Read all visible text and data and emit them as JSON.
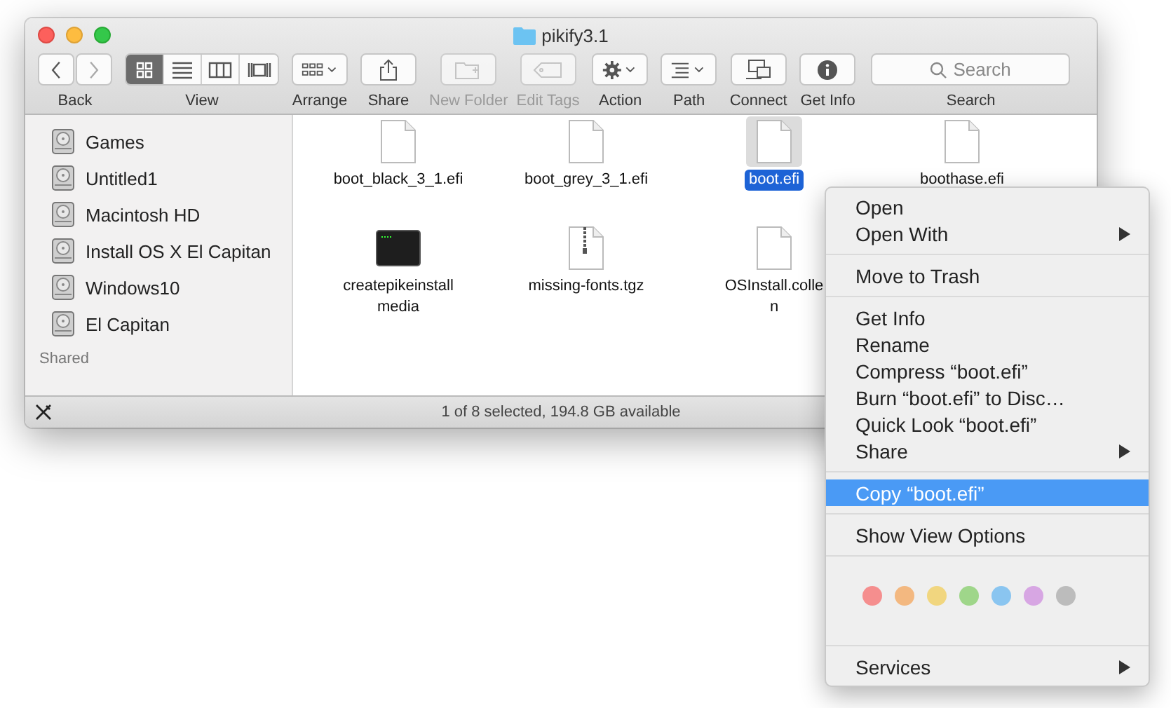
{
  "window": {
    "title": "pikify3.1"
  },
  "toolbar": [
    {
      "kind": "nav",
      "label": "Back",
      "disabled": false
    },
    {
      "kind": "view",
      "label": "View",
      "segments": [
        {
          "selected": true
        },
        {
          "selected": false
        },
        {
          "selected": false
        },
        {
          "selected": false
        }
      ]
    },
    {
      "kind": "arrange",
      "label": "Arrange",
      "disabled": false
    },
    {
      "kind": "share",
      "label": "Share",
      "disabled": false
    },
    {
      "kind": "newfolder",
      "label": "New Folder",
      "disabled": true
    },
    {
      "kind": "tags",
      "label": "Edit Tags",
      "disabled": true
    },
    {
      "kind": "action",
      "label": "Action",
      "disabled": false
    },
    {
      "kind": "path",
      "label": "Path",
      "disabled": false
    },
    {
      "kind": "connect",
      "label": "Connect",
      "disabled": false
    },
    {
      "kind": "info",
      "label": "Get Info",
      "disabled": false
    },
    {
      "kind": "search",
      "label": "Search",
      "placeholder": "Search"
    }
  ],
  "sidebar": {
    "items": [
      {
        "name": "Games",
        "selected": false
      },
      {
        "name": "Untitled1",
        "selected": false
      },
      {
        "name": "Macintosh HD",
        "selected": false
      },
      {
        "name": "Install OS X El Capitan",
        "selected": false
      },
      {
        "name": "Windows10",
        "selected": false
      },
      {
        "name": "El Capitan",
        "selected": false
      }
    ],
    "section": "Shared"
  },
  "files": [
    {
      "kind": "doc",
      "lines": [
        "boot_black_3_1.efi"
      ],
      "selected": false
    },
    {
      "kind": "doc",
      "lines": [
        "boot_grey_3_1.efi"
      ],
      "selected": false
    },
    {
      "kind": "doc",
      "lines": [
        "boot.efi"
      ],
      "selected": true
    },
    {
      "kind": "doc",
      "lines": [
        "boothase.efi"
      ],
      "selected": false
    },
    {
      "kind": "exec",
      "lines": [
        "createpikeinstall",
        "media"
      ],
      "selected": false
    },
    {
      "kind": "tgz",
      "lines": [
        "missing-fonts.tgz"
      ],
      "selected": false
    },
    {
      "kind": "doc",
      "lines": [
        "OSInstall.colle",
        "n"
      ],
      "selected": false
    }
  ],
  "status_bar": "1 of 8 selected, 194.8 GB available",
  "context_menu": {
    "sections": [
      [
        {
          "label": "Open",
          "submenu": false,
          "selected": false
        },
        {
          "label": "Open With",
          "submenu": true,
          "selected": false
        }
      ],
      [
        {
          "label": "Move to Trash",
          "submenu": false,
          "selected": false
        }
      ],
      [
        {
          "label": "Get Info",
          "submenu": false,
          "selected": false
        },
        {
          "label": "Rename",
          "submenu": false,
          "selected": false
        },
        {
          "label": "Compress “boot.efi”",
          "submenu": false,
          "selected": false
        },
        {
          "label": "Burn “boot.efi” to Disc…",
          "submenu": false,
          "selected": false
        },
        {
          "label": "Quick Look “boot.efi”",
          "submenu": false,
          "selected": false
        },
        {
          "label": "Share",
          "submenu": true,
          "selected": false
        }
      ],
      [
        {
          "label": "Copy “boot.efi”",
          "submenu": false,
          "selected": true
        }
      ],
      [
        {
          "label": "Show View Options",
          "submenu": false,
          "selected": false
        }
      ]
    ],
    "tags": [
      {
        "color": "#f58e8e"
      },
      {
        "color": "#f3b880"
      },
      {
        "color": "#f1d67f"
      },
      {
        "color": "#9fd68a"
      },
      {
        "color": "#8ac5f0"
      },
      {
        "color": "#d7a6e3"
      },
      {
        "color": "#bcbcbc"
      }
    ],
    "footer": [
      {
        "label": "Services",
        "submenu": true,
        "selected": false
      }
    ]
  }
}
